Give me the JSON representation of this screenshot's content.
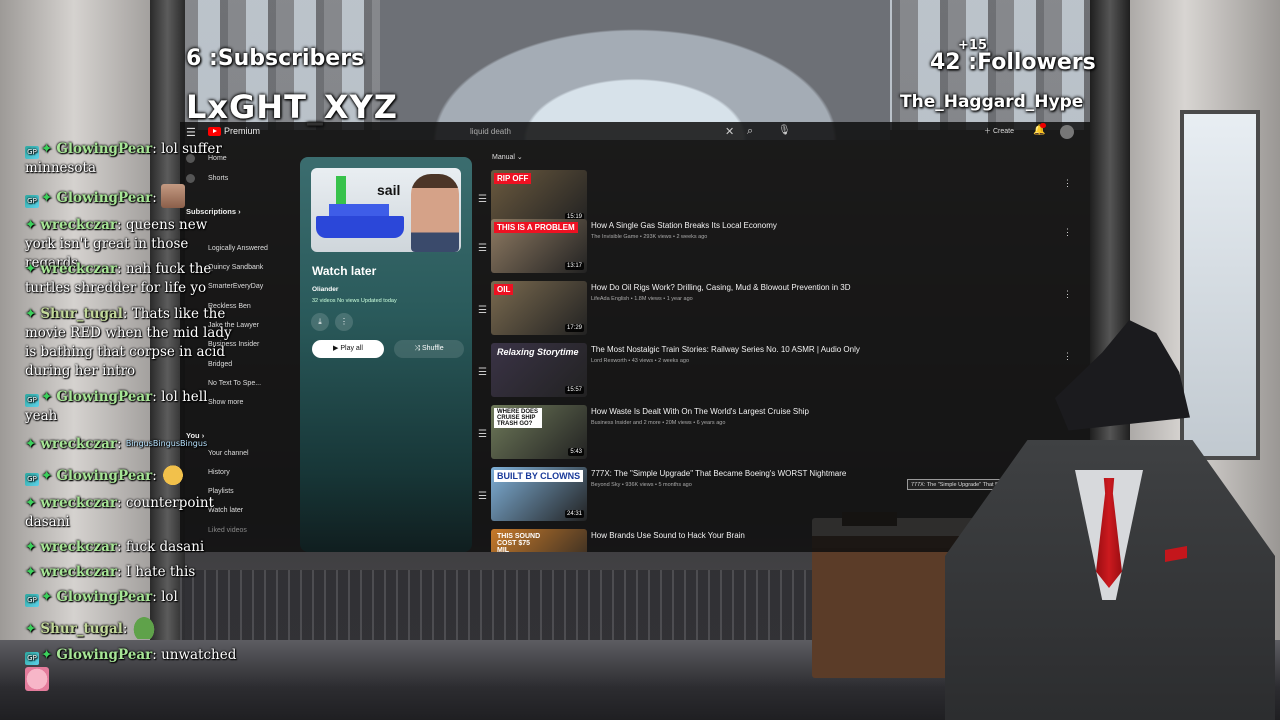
{
  "overlay": {
    "subscribers": "6 :Subscribers",
    "followers": "42 :Followers",
    "followers_delta": "+15",
    "channel_handle": "LxGHT_XYZ",
    "latest_follower": "The_Haggard_Hype"
  },
  "youtube": {
    "brand": "Premium",
    "search_value": "liquid death",
    "create_label": "Create",
    "sidebar": {
      "home": "Home",
      "shorts": "Shorts",
      "subscriptions": "Subscriptions",
      "subs": [
        "Logically Answered",
        "Quincy Sandbank",
        "SmarterEveryDay",
        "Reckless Ben",
        "Jake the Lawyer",
        "Business Insider",
        "Bridged",
        "No Text To Spe...",
        "Show more"
      ],
      "you": "You",
      "you_items": [
        "Your channel",
        "History",
        "Playlists",
        "Watch later",
        "Liked videos"
      ]
    },
    "playlist": {
      "thumb_text": "sail",
      "title": "Watch later",
      "owner": "Oliander",
      "meta": "32 videos  No views  Updated today",
      "play_all": "Play all",
      "shuffle": "Shuffle"
    },
    "sort_label": "Manual",
    "videos": [
      {
        "tag": "RIP OFF",
        "title": "",
        "meta": "",
        "duration": "15:19",
        "color": "#6b5a3f"
      },
      {
        "tag": "THIS IS A PROBLEM",
        "title": "How A Single Gas Station Breaks Its Local Economy",
        "meta": "The Invisible Game • 293K views • 2 weeks ago",
        "duration": "13:17",
        "color": "#8e7a62"
      },
      {
        "tag": "OIL",
        "title": "How Do Oil Rigs Work? Drilling, Casing, Mud & Blowout Prevention in 3D",
        "meta": "LifeAda English • 1.8M views • 1 year ago",
        "duration": "17:29",
        "color": "#7a6a4f"
      },
      {
        "tag": "Relaxing Storytime",
        "title": "The Most Nostalgic Train Stories: Railway Series No. 10 ASMR | Audio Only",
        "meta": "Lord Rexworth • 43 views • 2 weeks ago",
        "duration": "15:57",
        "color": "#3a3346"
      },
      {
        "tag": "WHERE DOES CRUISE SHIP TRASH GO?",
        "title": "How Waste Is Dealt With On The World's Largest Cruise Ship",
        "meta": "Business Insider and 2 more • 20M views • 6 years ago",
        "duration": "5:43",
        "color": "#6f7a5a"
      },
      {
        "tag": "BUILT BY CLOWNS",
        "title": "777X: The \"Simple Upgrade\" That Became Boeing's WORST Nightmare",
        "meta": "Beyond Sky • 936K views • 5 months ago",
        "duration": "24:31",
        "color": "#7fb0d8"
      },
      {
        "tag": "THIS SOUND COST $75 MIL",
        "title": "How Brands Use Sound to Hack Your Brain",
        "meta": "",
        "duration": "",
        "color": "#c77a2a"
      }
    ],
    "tooltip": "777X: The \"Simple Upgrade\" That Became..."
  },
  "chat": [
    {
      "user": "GlowingPear",
      "badge": true,
      "text": "lol suffer minnesota"
    },
    {
      "user": "GlowingPear",
      "badge": true,
      "text": "",
      "emote": "face"
    },
    {
      "user": "wreckczar",
      "badge": false,
      "text": "queens new york isn't great in those regards"
    },
    {
      "user": "wreckczar",
      "badge": false,
      "text": "nah fuck the turtles shredder for life yo"
    },
    {
      "user": "Shur_tugal",
      "badge": false,
      "text": "Thats like the movie RED when the mid lady is bathing that corpse in acid during her intro"
    },
    {
      "user": "GlowingPear",
      "badge": true,
      "text": "lol hell yeah"
    },
    {
      "user": "wreckczar",
      "badge": false,
      "text": "BingusBingusBingus"
    },
    {
      "user": "GlowingPear",
      "badge": true,
      "text": "",
      "emote": "dog"
    },
    {
      "user": "wreckczar",
      "badge": false,
      "text": "counterpoint dasani"
    },
    {
      "user": "wreckczar",
      "badge": false,
      "text": "fuck dasani"
    },
    {
      "user": "wreckczar",
      "badge": false,
      "text": "I hate this"
    },
    {
      "user": "GlowingPear",
      "badge": true,
      "text": "lol"
    },
    {
      "user": "Shur_tugal",
      "badge": false,
      "text": "",
      "emote": "pepe"
    },
    {
      "user": "GlowingPear",
      "badge": true,
      "text": "unwatched"
    }
  ]
}
